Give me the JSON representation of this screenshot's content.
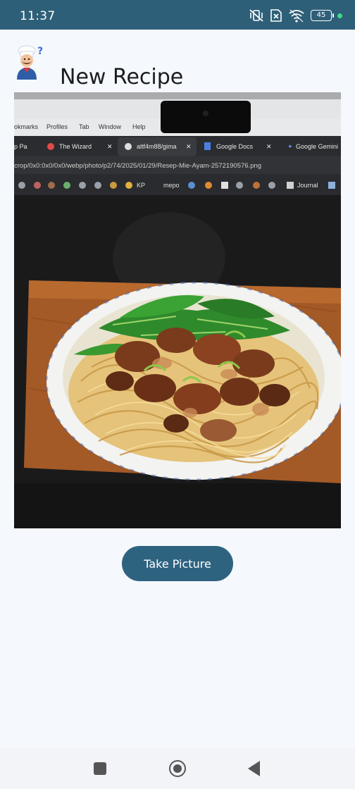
{
  "status_bar": {
    "time": "11:37",
    "battery_level": "45",
    "icons": [
      "vibrate-off-icon",
      "no-sim-icon",
      "wifi-icon",
      "battery-icon",
      "charging-dot-icon"
    ]
  },
  "header": {
    "title": "New Recipe",
    "logo_icon": "chef-icon"
  },
  "photo": {
    "browser_menu": [
      "okmarks",
      "Profiles",
      "Tab",
      "Window",
      "Help"
    ],
    "browser_tabs": [
      "p Pa",
      "The Wizard",
      "altf4m88/gima",
      "Google Docs",
      "Google Gemini"
    ],
    "browser_url": "crop/0x0:0x0/0x0/webp/photo/p2/74/2025/01/29/Resep-Mie-Ayam-2572190576.png",
    "bookmarks": [
      "KP",
      "mepo",
      "Journal"
    ]
  },
  "actions": {
    "take_picture_label": "Take Picture"
  },
  "nav": {
    "icons": [
      "recents-icon",
      "home-icon",
      "back-icon"
    ]
  },
  "colors": {
    "status_bar": "#2e5f78",
    "primary_button": "#2e6380",
    "background": "#f5f8fc"
  }
}
